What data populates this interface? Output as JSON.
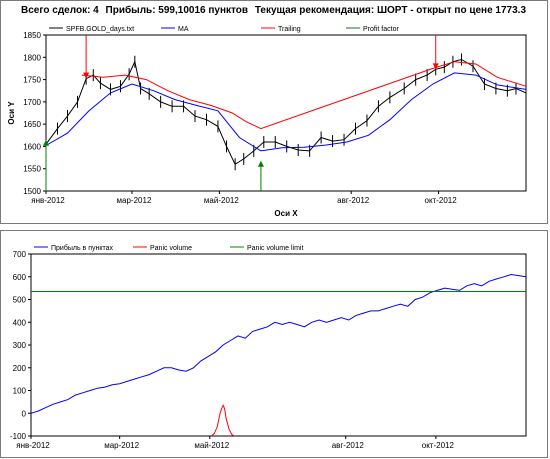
{
  "header": {
    "trades": "Всего сделок:  4",
    "profit": "Прибыль: 599,10016 пунктов",
    "recommendation": "Текущая рекомендация: ШОРТ - открыт по цене 1773.3"
  },
  "chart_data": [
    {
      "type": "line",
      "title": "",
      "xlabel": "Оси X",
      "ylabel": "Оси Y",
      "ylim": [
        1500,
        1850
      ],
      "yticks": [
        1500,
        1550,
        1600,
        1650,
        1700,
        1750,
        1800,
        1850
      ],
      "xtick_labels": [
        "янв-2012",
        "мар-2012",
        "май-2012",
        "авг-2012",
        "окт-2012"
      ],
      "xtick_positions": [
        0,
        60,
        121,
        213,
        274
      ],
      "x_extent": [
        0,
        335
      ],
      "legend": [
        "SPFB.GOLD_days.txt",
        "MA",
        "Trailing",
        "Profit factor"
      ],
      "colors": {
        "price": "#000000",
        "ma": "#0000ff",
        "trailing": "#ff0000",
        "profit_factor": "#008000"
      },
      "series": [
        {
          "name": "SPFB.GOLD_days.txt",
          "x": [
            0,
            8,
            15,
            22,
            28,
            33,
            38,
            45,
            52,
            58,
            62,
            66,
            72,
            80,
            88,
            96,
            104,
            112,
            120,
            126,
            132,
            138,
            145,
            152,
            160,
            168,
            176,
            184,
            192,
            200,
            208,
            216,
            224,
            232,
            240,
            250,
            258,
            266,
            272,
            278,
            284,
            290,
            298,
            306,
            314,
            322,
            328,
            335
          ],
          "values": [
            1605,
            1640,
            1668,
            1700,
            1752,
            1760,
            1742,
            1728,
            1735,
            1762,
            1790,
            1730,
            1718,
            1700,
            1690,
            1690,
            1668,
            1660,
            1645,
            1600,
            1560,
            1572,
            1590,
            1610,
            1610,
            1600,
            1592,
            1590,
            1620,
            1612,
            1615,
            1640,
            1658,
            1690,
            1710,
            1730,
            1750,
            1760,
            1773,
            1778,
            1790,
            1795,
            1780,
            1740,
            1730,
            1725,
            1730,
            1720
          ]
        },
        {
          "name": "MA",
          "x": [
            0,
            15,
            30,
            45,
            60,
            75,
            90,
            105,
            120,
            135,
            150,
            165,
            180,
            195,
            210,
            225,
            240,
            255,
            270,
            285,
            300,
            315,
            335
          ],
          "values": [
            1602,
            1630,
            1680,
            1720,
            1740,
            1725,
            1705,
            1692,
            1680,
            1620,
            1590,
            1597,
            1598,
            1603,
            1610,
            1625,
            1660,
            1705,
            1740,
            1765,
            1760,
            1738,
            1728
          ]
        },
        {
          "name": "Trailing",
          "x": [
            25,
            40,
            55,
            70,
            85,
            100,
            115,
            130,
            140,
            150,
            270,
            285,
            300,
            315,
            335
          ],
          "values": [
            1760,
            1755,
            1760,
            1750,
            1725,
            1705,
            1692,
            1675,
            1655,
            1640,
            1775,
            1790,
            1785,
            1755,
            1735
          ]
        }
      ],
      "signals": [
        {
          "kind": "buy",
          "x": 0,
          "value": 1615
        },
        {
          "kind": "sell",
          "x": 28,
          "value": 1752
        },
        {
          "kind": "buy",
          "x": 150,
          "value": 1568
        },
        {
          "kind": "sell",
          "x": 272,
          "value": 1773
        }
      ]
    },
    {
      "type": "line",
      "title": "",
      "ylim": [
        -100,
        700
      ],
      "yticks": [
        -100,
        0,
        100,
        200,
        300,
        400,
        500,
        600,
        700
      ],
      "xtick_labels": [
        "янв-2012",
        "мар-2012",
        "май-2012",
        "авг-2012",
        "окт-2012"
      ],
      "xtick_positions": [
        0,
        60,
        121,
        213,
        274
      ],
      "x_extent": [
        0,
        335
      ],
      "legend": [
        "Прибыль в пунктах",
        "Panic volume",
        "Panic volume limit"
      ],
      "colors": {
        "profit": "#0000ff",
        "panic": "#ff0000",
        "limit": "#008000"
      },
      "series": [
        {
          "name": "Прибыль в пунктах",
          "x": [
            0,
            5,
            10,
            15,
            20,
            25,
            30,
            35,
            40,
            45,
            50,
            55,
            60,
            65,
            70,
            75,
            80,
            85,
            90,
            95,
            100,
            105,
            110,
            115,
            120,
            125,
            130,
            135,
            140,
            145,
            150,
            155,
            160,
            165,
            170,
            175,
            180,
            185,
            190,
            195,
            200,
            205,
            210,
            215,
            220,
            225,
            230,
            235,
            240,
            245,
            250,
            255,
            260,
            265,
            270,
            275,
            280,
            285,
            290,
            295,
            300,
            305,
            310,
            315,
            320,
            325,
            330,
            335
          ],
          "values": [
            0,
            10,
            25,
            40,
            50,
            60,
            80,
            90,
            100,
            110,
            115,
            125,
            130,
            140,
            150,
            160,
            170,
            185,
            200,
            200,
            190,
            185,
            200,
            230,
            250,
            270,
            300,
            320,
            340,
            330,
            360,
            370,
            380,
            400,
            390,
            400,
            390,
            380,
            400,
            410,
            400,
            410,
            420,
            410,
            430,
            440,
            450,
            450,
            460,
            470,
            480,
            470,
            500,
            510,
            530,
            540,
            550,
            545,
            540,
            560,
            570,
            560,
            580,
            590,
            600,
            610,
            605,
            600
          ]
        },
        {
          "name": "Panic volume",
          "x": [
            122,
            124,
            126,
            128,
            129,
            130,
            131,
            132,
            134,
            136,
            138
          ],
          "values": [
            -100,
            -90,
            -60,
            0,
            20,
            35,
            20,
            -20,
            -70,
            -95,
            -100
          ]
        },
        {
          "name": "Panic volume limit",
          "x": [
            0,
            335
          ],
          "values": [
            535,
            535
          ]
        }
      ]
    }
  ]
}
